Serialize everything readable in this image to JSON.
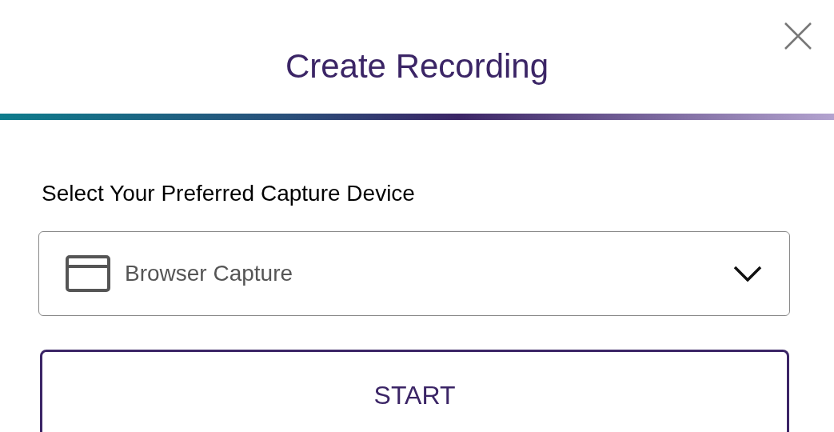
{
  "dialog": {
    "title": "Create Recording"
  },
  "capture_device": {
    "label": "Select Your Preferred Capture Device",
    "value": "Browser Capture"
  },
  "buttons": [
    "START"
  ]
}
